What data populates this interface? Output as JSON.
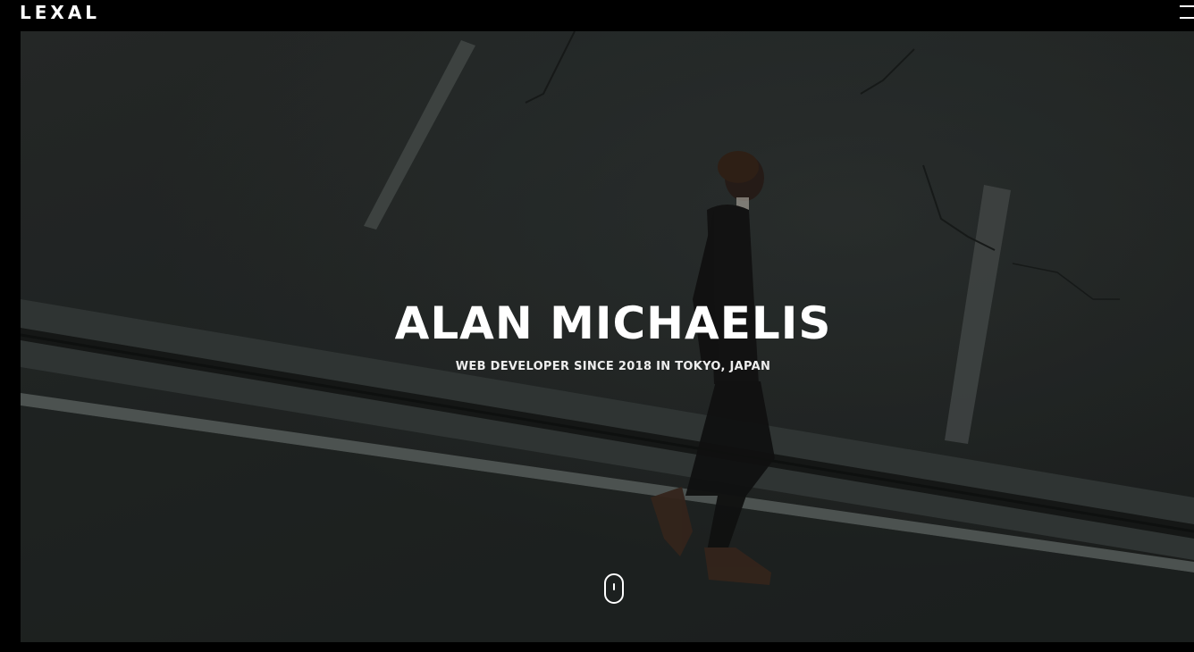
{
  "header": {
    "logo": "LEXAL",
    "menu_icon": "hamburger-menu-icon"
  },
  "hero": {
    "title": "ALAN MICHAELIS",
    "subtitle": "WEB DEVELOPER SINCE 2018 IN TOKYO, JAPAN",
    "scroll_icon": "mouse-scroll-icon",
    "background_image": "man-walking-on-street-photo"
  },
  "colors": {
    "page_background": "#000000",
    "text": "#ffffff",
    "asphalt": "#2a2e2d"
  }
}
